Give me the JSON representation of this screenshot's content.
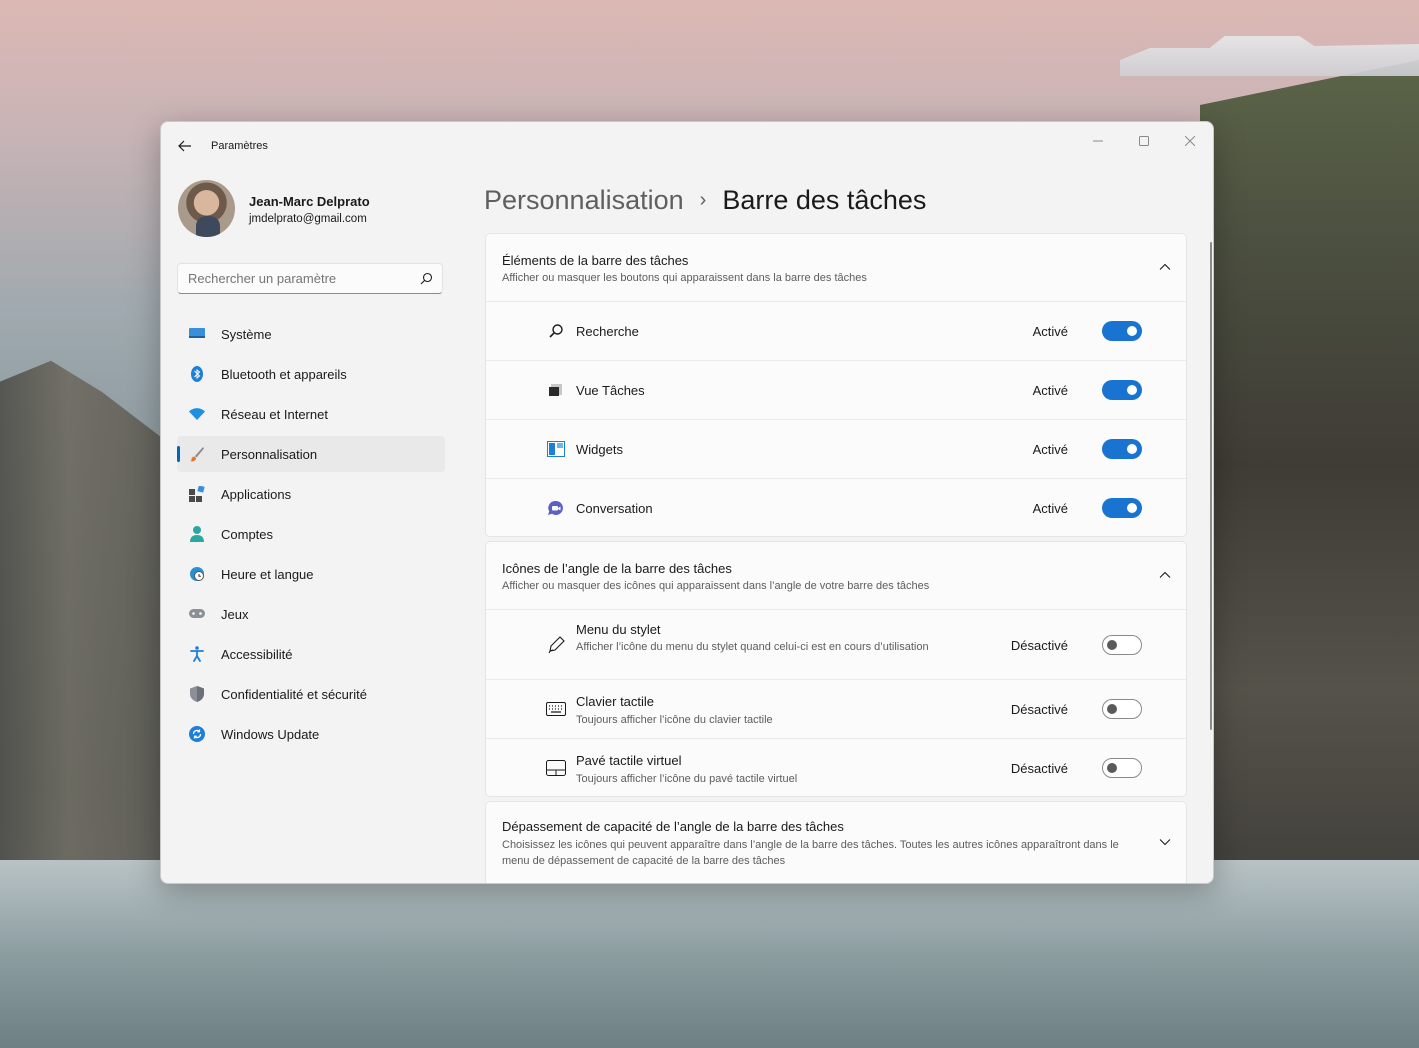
{
  "window": {
    "title": "Paramètres"
  },
  "profile": {
    "name": "Jean-Marc Delprato",
    "email": "jmdelprato@gmail.com"
  },
  "search": {
    "placeholder": "Rechercher un paramètre"
  },
  "sidebar": {
    "items": [
      {
        "label": "Système",
        "icon": "system-icon",
        "active": false
      },
      {
        "label": "Bluetooth et appareils",
        "icon": "bluetooth-icon",
        "active": false
      },
      {
        "label": "Réseau et Internet",
        "icon": "wifi-icon",
        "active": false
      },
      {
        "label": "Personnalisation",
        "icon": "brush-icon",
        "active": true
      },
      {
        "label": "Applications",
        "icon": "apps-icon",
        "active": false
      },
      {
        "label": "Comptes",
        "icon": "account-icon",
        "active": false
      },
      {
        "label": "Heure et langue",
        "icon": "clock-globe-icon",
        "active": false
      },
      {
        "label": "Jeux",
        "icon": "gamepad-icon",
        "active": false
      },
      {
        "label": "Accessibilité",
        "icon": "accessibility-icon",
        "active": false
      },
      {
        "label": "Confidentialité et sécurité",
        "icon": "shield-icon",
        "active": false
      },
      {
        "label": "Windows Update",
        "icon": "update-icon",
        "active": false
      }
    ]
  },
  "breadcrumb": {
    "parent": "Personnalisation",
    "separator": "›",
    "current": "Barre des tâches"
  },
  "sections": {
    "taskbar_items": {
      "title": "Éléments de la barre des tâches",
      "subtitle": "Afficher ou masquer les boutons qui apparaissent dans la barre des tâches",
      "expanded": true,
      "rows": [
        {
          "label": "Recherche",
          "state": "Activé",
          "on": true,
          "icon": "search-icon"
        },
        {
          "label": "Vue Tâches",
          "state": "Activé",
          "on": true,
          "icon": "task-view-icon"
        },
        {
          "label": "Widgets",
          "state": "Activé",
          "on": true,
          "icon": "widgets-icon"
        },
        {
          "label": "Conversation",
          "state": "Activé",
          "on": true,
          "icon": "chat-icon"
        }
      ]
    },
    "corner_icons": {
      "title": "Icônes de l’angle de la barre des tâches",
      "subtitle": "Afficher ou masquer des icônes qui apparaissent dans l’angle de votre barre des tâches",
      "expanded": true,
      "rows": [
        {
          "label": "Menu du stylet",
          "desc": "Afficher l’icône du menu du stylet quand celui-ci est en cours d’utilisation",
          "state": "Désactivé",
          "on": false,
          "icon": "pen-icon"
        },
        {
          "label": "Clavier tactile",
          "desc": "Toujours afficher l’icône du clavier tactile",
          "state": "Désactivé",
          "on": false,
          "icon": "keyboard-icon"
        },
        {
          "label": "Pavé tactile virtuel",
          "desc": "Toujours afficher l’icône du pavé tactile virtuel",
          "state": "Désactivé",
          "on": false,
          "icon": "touchpad-icon"
        }
      ]
    },
    "corner_overflow": {
      "title": "Dépassement de capacité de l’angle de la barre des tâches",
      "subtitle": "Choisissez les icônes qui peuvent apparaître dans l’angle de la barre des tâches. Toutes les autres icônes apparaîtront dans le menu de dépassement de capacité de la barre des tâches",
      "expanded": false
    }
  },
  "colors": {
    "accent": "#1874d0",
    "window_bg": "#f3f3f3",
    "card_bg": "#fbfbfb"
  }
}
